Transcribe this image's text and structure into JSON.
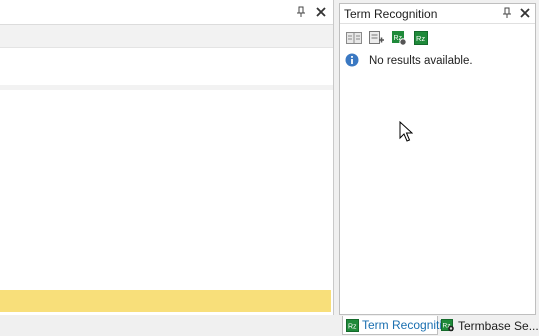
{
  "right_panel": {
    "title": "Term Recognition",
    "message": "No results available.",
    "toolbar": [
      {
        "name": "termbase-viewer-icon"
      },
      {
        "name": "add-term-icon"
      },
      {
        "name": "termbase-settings-icon"
      },
      {
        "name": "term-recognition-options-icon"
      }
    ]
  },
  "bottom_tabs": [
    {
      "label": "Term Recogniti...",
      "active": true,
      "icon": "term-recognition-icon"
    },
    {
      "label": "Termbase Se...",
      "active": false,
      "icon": "termbase-search-icon"
    }
  ],
  "colors": {
    "highlight_row": "#f8df7a",
    "active_tab_text": "#1a6fb0",
    "info_icon": "#3a78c2",
    "term_icon_green": "#1f8a3a"
  }
}
